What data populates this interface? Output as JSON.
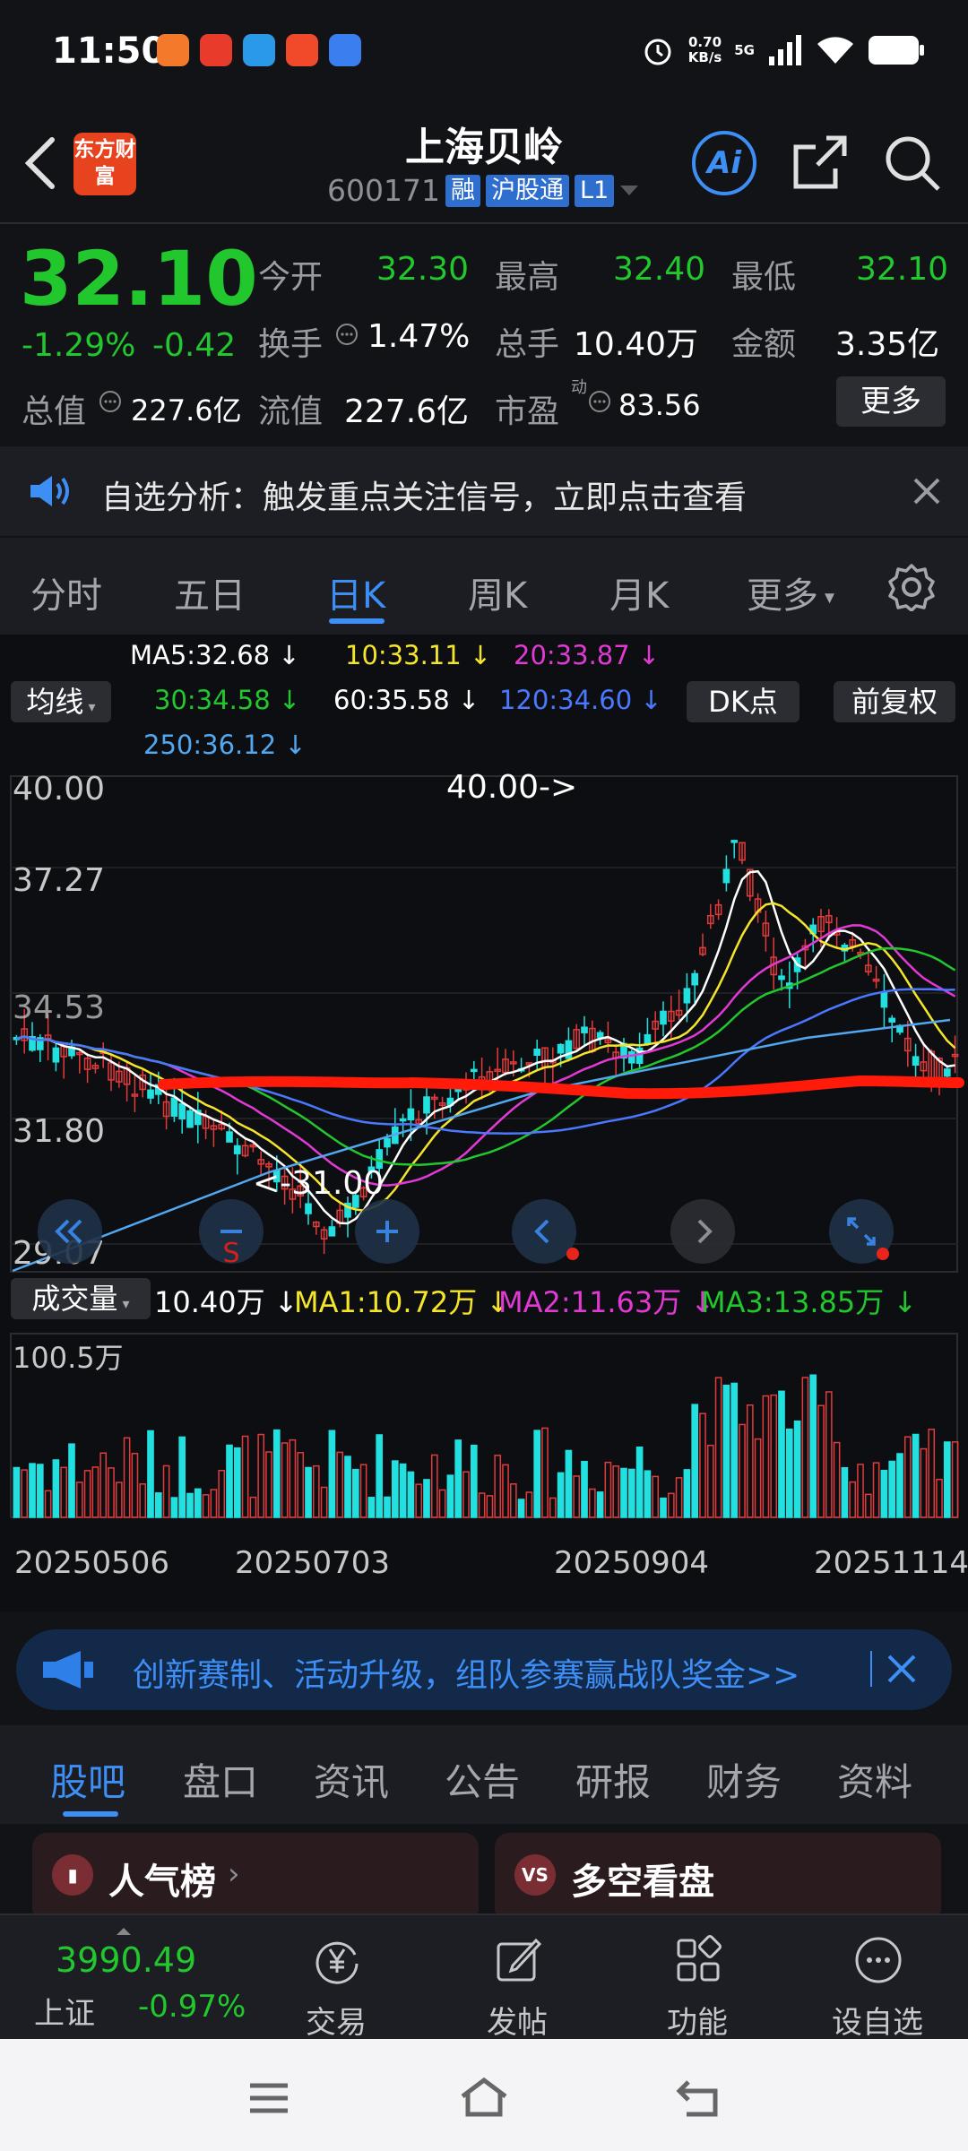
{
  "status": {
    "time": "11:50",
    "net_speed": "0.70",
    "net_unit": "KB/s",
    "signal": "5G"
  },
  "header": {
    "logo": "东方财富",
    "title": "上海贝岭",
    "code": "600171",
    "tags": [
      "融",
      "沪股通",
      "L1"
    ],
    "ai": "Ai"
  },
  "quote": {
    "price": "32.10",
    "change_pct": "-1.29%",
    "change": "-0.42",
    "open_label": "今开",
    "open": "32.30",
    "high_label": "最高",
    "high": "32.40",
    "low_label": "最低",
    "low": "32.10",
    "turnover_label": "换手",
    "turnover": "1.47%",
    "volume_label": "总手",
    "volume": "10.40万",
    "amount_label": "金额",
    "amount": "3.35亿",
    "mktcap_label": "总值",
    "mktcap": "227.6亿",
    "float_label": "流值",
    "float": "227.6亿",
    "pe_label": "市盈",
    "pe_sup": "动",
    "pe": "83.56",
    "more": "更多"
  },
  "notice": {
    "text": "自选分析：触发重点关注信号，立即点击查看"
  },
  "tabs": [
    "分时",
    "五日",
    "日K",
    "周K",
    "月K",
    "更多"
  ],
  "active_tab": "日K",
  "ma_legend": {
    "selector": "均线",
    "ma5": "MA5:32.68 ↓",
    "ma10": "10:33.11 ↓",
    "ma20": "20:33.87 ↓",
    "ma30": "30:34.58 ↓",
    "ma60": "60:35.58 ↓",
    "ma120": "120:34.60 ↓",
    "ma250": "250:36.12 ↓",
    "dk": "DK点",
    "adjust": "前复权"
  },
  "price_axis": [
    "40.00",
    "37.27",
    "34.53",
    "31.80",
    "29.07"
  ],
  "annotations": {
    "high": "40.00->",
    "low": "<-31.00"
  },
  "vol_legend": {
    "selector": "成交量",
    "vol": "10.40万 ↓",
    "ma1": "MA1:10.72万 ↓",
    "ma2": "MA2:11.63万 ↓",
    "ma3": "MA3:13.85万 ↓",
    "max": "100.5万"
  },
  "dates": [
    "20250506",
    "20250703",
    "20250904",
    "20251114"
  ],
  "banner": {
    "text": "创新赛制、活动升级，组队参赛赢战队奖金>>"
  },
  "subtabs": [
    "股吧",
    "盘口",
    "资讯",
    "公告",
    "研报",
    "财务",
    "资料"
  ],
  "active_subtab": "股吧",
  "cards": {
    "left": "人气榜",
    "right": "多空看盘",
    "right_icon": "VS"
  },
  "bottom": {
    "index_value": "3990.49",
    "index_name": "上证",
    "index_change": "-0.97%",
    "nav": [
      "交易",
      "发帖",
      "功能",
      "设自选"
    ]
  },
  "colors": {
    "up": "#e23b3b",
    "down": "#22c72e",
    "accent": "#3d8ef5",
    "cyan_bar": "#22e0e0"
  }
}
